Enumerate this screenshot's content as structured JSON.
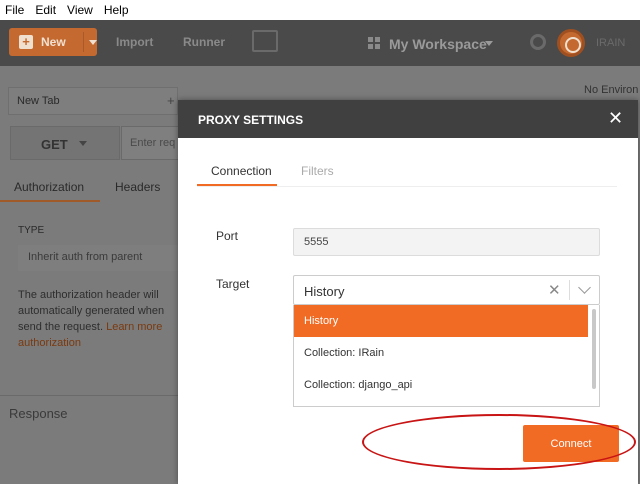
{
  "menubar": {
    "items": [
      "File",
      "Edit",
      "View",
      "Help"
    ]
  },
  "toolbar": {
    "new_label": "New",
    "import_label": "Import",
    "runner_label": "Runner",
    "workspace_label": "My Workspace",
    "user_label": "IRAIN"
  },
  "environment": {
    "label": "No Environ"
  },
  "request": {
    "tab_label": "New Tab",
    "tab_add": "+",
    "method": "GET",
    "url_placeholder": "Enter req",
    "subtabs": [
      "Authorization",
      "Headers"
    ],
    "auth_type_label": "TYPE",
    "auth_type_value": "Inherit auth from parent",
    "auth_desc_lines": [
      "The authorization header will",
      "automatically generated when",
      "send the request."
    ],
    "auth_link_part1": "Learn more",
    "auth_link_part2": "authorization",
    "response_label": "Response"
  },
  "modal": {
    "title": "PROXY SETTINGS",
    "close_glyph": "✕",
    "tabs": [
      "Connection",
      "Filters"
    ],
    "port_label": "Port",
    "port_value": "5555",
    "target_label": "Target",
    "target_value": "History",
    "clear_glyph": "✕",
    "options": [
      "History",
      "Collection: IRain",
      "Collection: django_api"
    ],
    "connect_label": "Connect"
  },
  "colors": {
    "accent": "#f26b24",
    "header_dark": "#404040",
    "annotation": "#c81414"
  }
}
